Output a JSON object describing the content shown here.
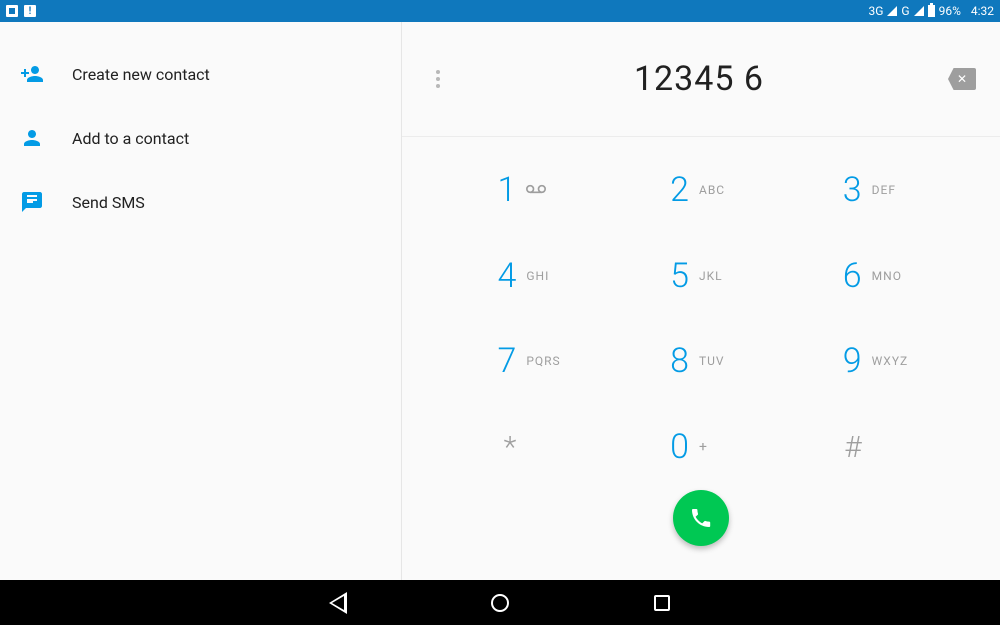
{
  "status": {
    "net1": "3G",
    "net2": "G",
    "battery_pct": "96%",
    "time": "4:32"
  },
  "actions": {
    "create": "Create new contact",
    "add": "Add to a contact",
    "sms": "Send SMS"
  },
  "dialed_number": "12345 6",
  "keys": {
    "k1": {
      "d": "1",
      "l": "∞"
    },
    "k2": {
      "d": "2",
      "l": "ABC"
    },
    "k3": {
      "d": "3",
      "l": "DEF"
    },
    "k4": {
      "d": "4",
      "l": "GHI"
    },
    "k5": {
      "d": "5",
      "l": "JKL"
    },
    "k6": {
      "d": "6",
      "l": "MNO"
    },
    "k7": {
      "d": "7",
      "l": "PQRS"
    },
    "k8": {
      "d": "8",
      "l": "TUV"
    },
    "k9": {
      "d": "9",
      "l": "WXYZ"
    },
    "kstar": {
      "d": "*",
      "l": ""
    },
    "k0": {
      "d": "0",
      "l": "+"
    },
    "khash": {
      "d": "#",
      "l": ""
    }
  },
  "colors": {
    "accent": "#039be5",
    "status_bar": "#0f78bd",
    "call": "#00c853"
  }
}
